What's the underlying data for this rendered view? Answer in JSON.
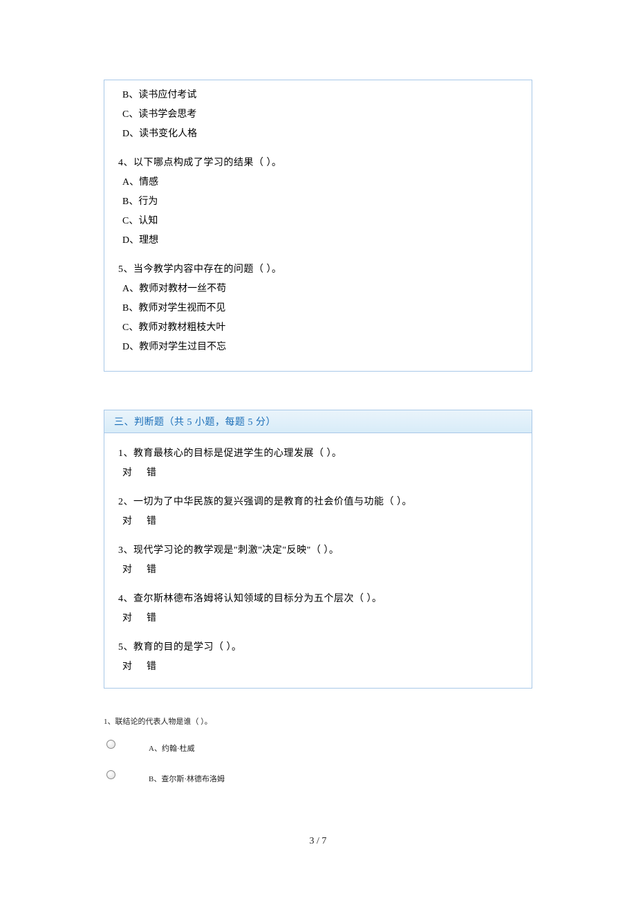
{
  "box1": {
    "q3_continued_options": [
      "B、读书应付考试",
      "C、读书学会思考",
      "D、读书变化人格"
    ],
    "q4": {
      "stem": "4、以下哪点构成了学习的结果（ ）。",
      "options": [
        "A、情感",
        "B、行为",
        "C、认知",
        "D、理想"
      ]
    },
    "q5": {
      "stem": "5、当今教学内容中存在的问题（ ）。",
      "options": [
        "A、教师对教材一丝不苟",
        "B、教师对学生视而不见",
        "C、教师对教材粗枝大叶",
        "D、教师对学生过目不忘"
      ]
    }
  },
  "section3": {
    "header": "三、判断题（共 5 小题，每题 5 分）",
    "items": [
      {
        "stem": "1、教育最核心的目标是促进学生的心理发展（ ）。",
        "true": "对",
        "false": "错"
      },
      {
        "stem": "2、一切为了中华民族的复兴强调的是教育的社会价值与功能（ ）。",
        "true": "对",
        "false": "错"
      },
      {
        "stem": "3、现代学习论的教学观是\"刺激\"决定\"反映\"（ ）。",
        "true": "对",
        "false": "错"
      },
      {
        "stem": "4、查尔斯林德布洛姆将认知领域的目标分为五个层次（ ）。",
        "true": "对",
        "false": "错"
      },
      {
        "stem": "5、教育的目的是学习（ ）。",
        "true": "对",
        "false": "错"
      }
    ]
  },
  "below": {
    "q1": {
      "stem": "1、联结论的代表人物是谁（ ）。",
      "options": [
        "A、约翰·杜威",
        "B、查尔斯·林德布洛姆"
      ]
    }
  },
  "footer": "3 / 7"
}
